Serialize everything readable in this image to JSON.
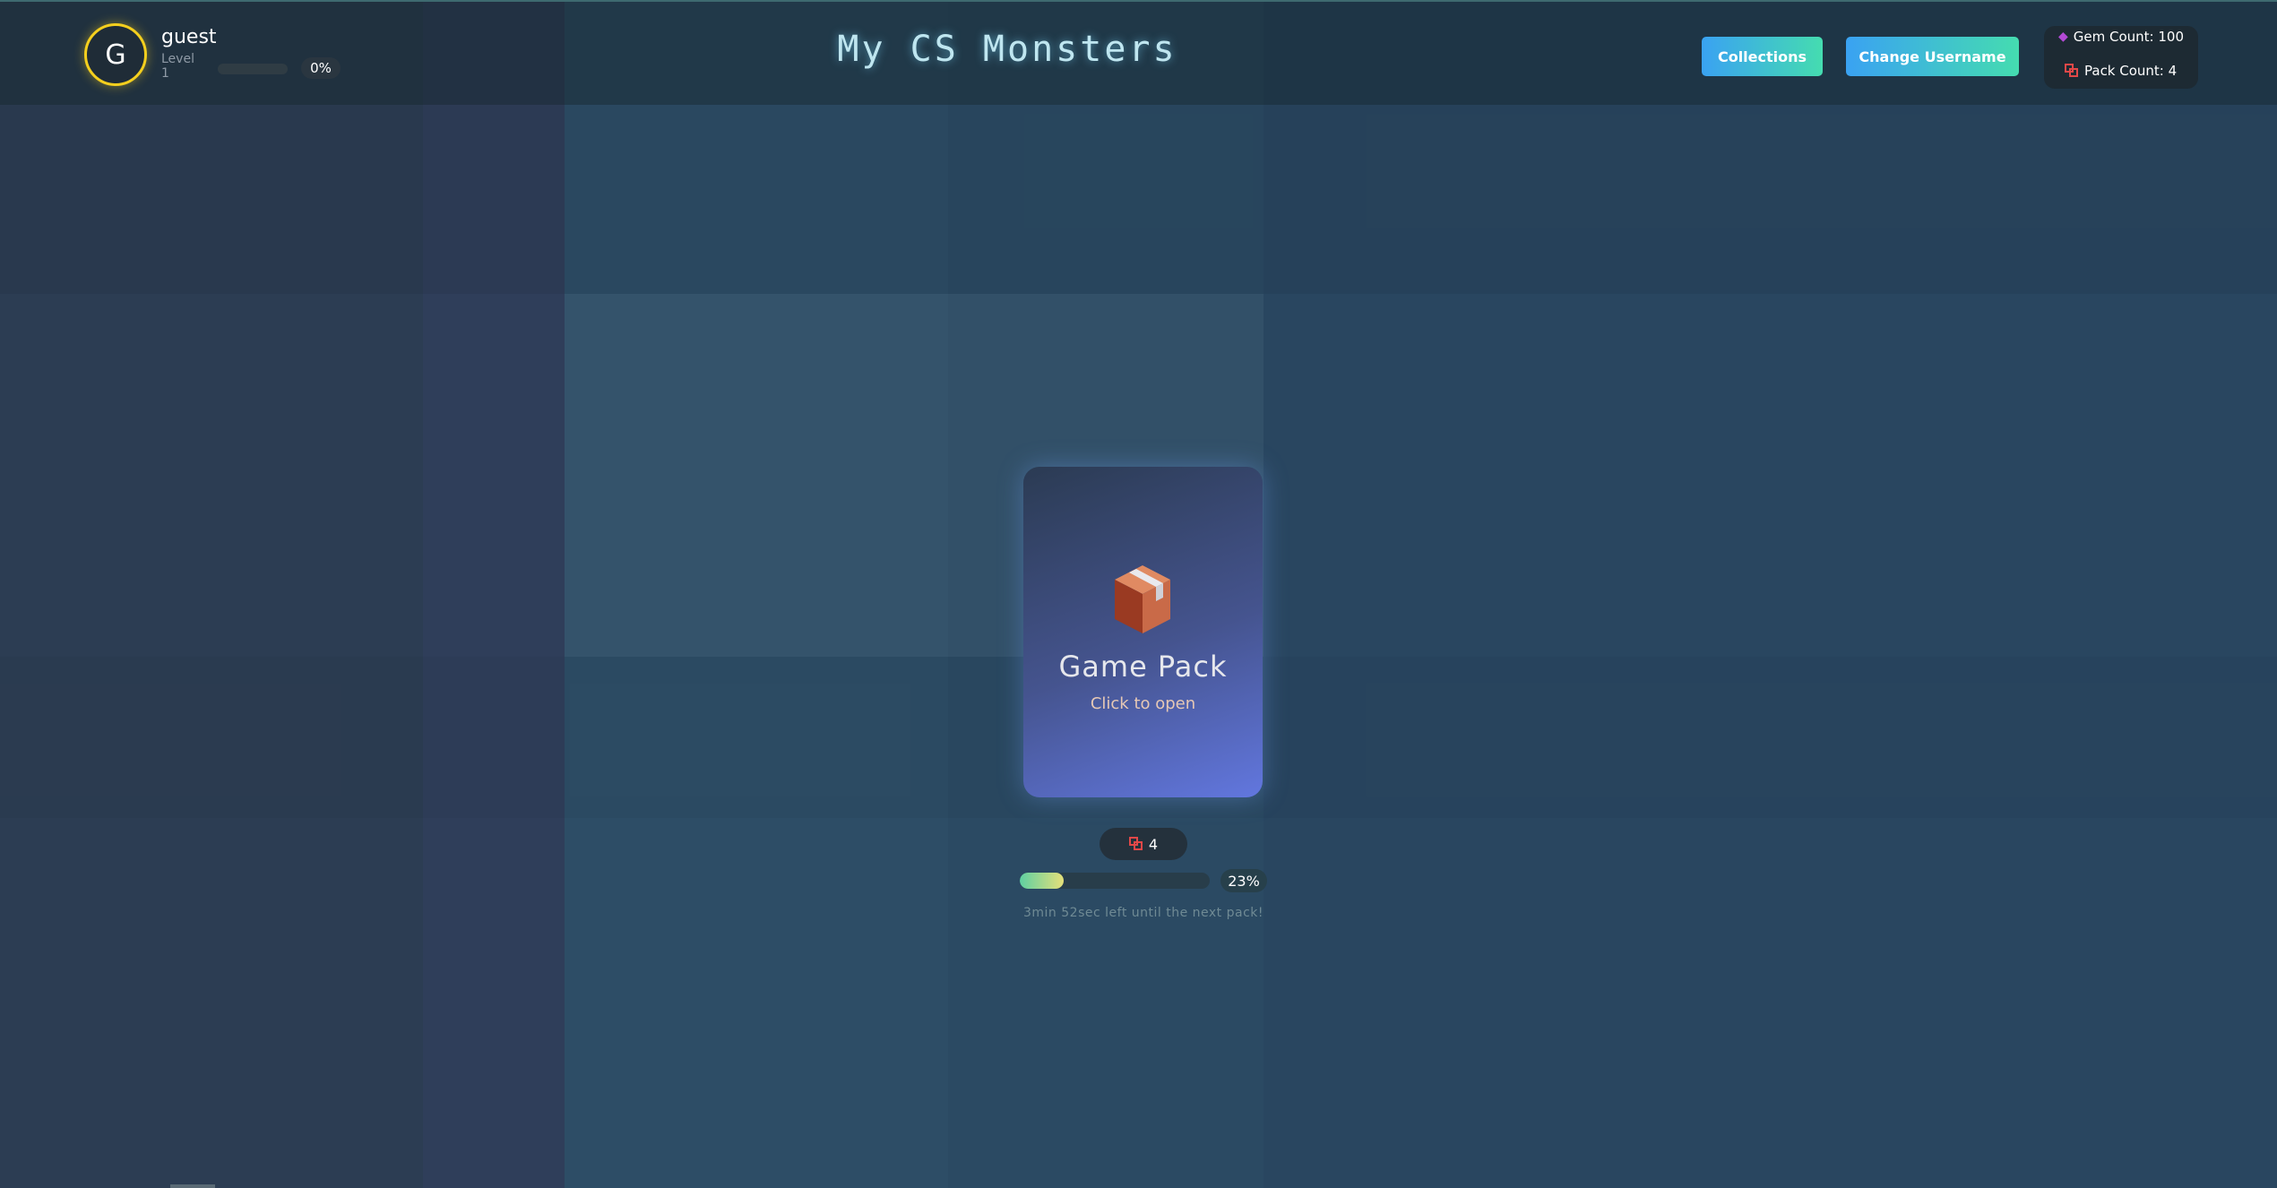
{
  "user": {
    "avatar_letter": "G",
    "username": "guest",
    "level_label": "Level",
    "level_value": "1",
    "xp_percent_label": "0%",
    "xp_progress": 0
  },
  "header": {
    "title": "My CS Monsters",
    "collections_label": "Collections",
    "change_username_label": "Change Username"
  },
  "stats": {
    "gem_label": "Gem Count: 100",
    "pack_label": "Pack Count: 4",
    "gem_icon": "diamond-icon",
    "pack_icon": "pack-icon"
  },
  "pack": {
    "icon": "box-icon",
    "title": "Game Pack",
    "subtitle": "Click to open",
    "count": "4",
    "progress_label": "23%",
    "progress": 0.23,
    "timer_text": "3min 52sec left until the next pack!"
  },
  "colors": {
    "accent_gradient_start": "#3aa2f2",
    "accent_gradient_end": "#45dcb0",
    "avatar_ring": "#f4cf1e",
    "gem": "#b34ad6",
    "pack": "#e24848"
  }
}
